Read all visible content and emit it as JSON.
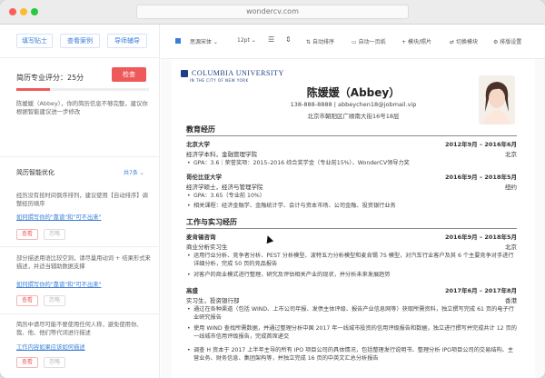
{
  "browser": {
    "url": "wondercv.com"
  },
  "sidebar": {
    "top_buttons": [
      "填写贴士",
      "查看案例",
      "导师辅导"
    ],
    "score_label": "简历专业评分：25分",
    "check_button": "检查",
    "score_percent": 25,
    "intro_text": "陈媛媛（Abbey），你的简历信息不够完整，建议你根据智能建议进一步修改",
    "optimize_title": "简历智能优化",
    "optimize_count": "共7条 ⌄",
    "suggestions": [
      {
        "text": "经历没有按时间倒序排列，建议使用【自动排序】调整经历顺序",
        "link": "如何撰写你的\"靠谱\"和\"可不出来\"",
        "view": "查看",
        "ignore": "忽略"
      },
      {
        "text": "部分描述用语比较空洞，请尽量用动词 + 结果形式来描述，并适当辅助数据支撑",
        "link": "如何撰写你的\"靠谱\"和\"可不出来\"",
        "view": "查看",
        "ignore": "忽略"
      },
      {
        "text": "简历中请尽可能不要使用任何人称，避免使用你、我、他、他们等代词进行描述",
        "link": "工作内容如果应该如何描述",
        "view": "查看",
        "ignore": "忽略"
      }
    ]
  },
  "toolbar": {
    "font": "思源宋体 ⌄",
    "size": "12pt ⌄",
    "items": [
      "自动排序",
      "自动一页纸",
      "模块/照片",
      "切换模块",
      "排版设置"
    ]
  },
  "resume": {
    "logo_main": "COLUMBIA UNIVERSITY",
    "logo_sub": "IN THE CITY OF NEW YORK",
    "name": "陈媛媛（Abbey）",
    "contact": "138-888-8888 | abbeychen18@jobmail.vip",
    "address": "北京市朝阳区广顺南大街16号18层",
    "edu_title": "教育经历",
    "edu": [
      {
        "school": "北京大学",
        "date": "2012年9月 – 2016年6月",
        "degree": "经济学本科，金融管理学院",
        "place": "北京",
        "bullets": [
          "GPA：3.6｜荣誉奖项：2015–2016 综合奖学金（专业前15%）、WonderCV领导力奖"
        ]
      },
      {
        "school": "哥伦比亚大学",
        "date": "2016年9月 – 2018年5月",
        "degree": "经济学硕士，经济与管理学院",
        "place": "纽约",
        "bullets": [
          "GPA：3.65（专业前 10%）",
          "相关课程：经济金融学、金融统计学、会计与资本市场、公司金融、投资银行业务"
        ]
      }
    ],
    "work_title": "工作与实习经历",
    "work": [
      {
        "company": "麦肯锡咨询",
        "date": "2016年9月 – 2018年5月",
        "role": "商业分析实习生",
        "place": "北京",
        "bullets": [
          "运用行业分析、竞争者分析、PEST 分析模型、波特五力分析模型和麦肯锡 7S 模型，对汽车行业客户及其 6 个主要竞争对手进行详细分析，完成 50 页的竞品报告",
          "对客户的商业模式进行整理，研究及评估相关产业的现状，并分析未来发展趋势"
        ]
      },
      {
        "company": "高盛",
        "date": "2017年6月 – 2017年8月",
        "role": "实习生，投资银行部",
        "place": "香港",
        "bullets": [
          "通过在各种渠道（包括 WIND、上市公司年报、发债主体评级、报告产业信息网等）获取所需资料，独立撰写完成 61 页的电子行业研究报告",
          "使用 WIND 查找所需数据，并通过整理分析中国 2017 年一线城市投资的信用评级报告和数据，独立进行撰写并完成共计 12 页的一线城市信用评级报告，完成首席递交"
        ]
      }
    ],
    "extra_bullet": "调查 H 资本于 2017 上半年主导的所有 IPO 项目公司的具体情况，包括整理发行说明书、整理分析 IPO项目公司的交易结构、主营业务、财务信息、集团架构等，并独立完成 16 页的中英文汇总分析报告"
  },
  "colors": {
    "accent_blue": "#3a7ed8",
    "accent_red": "#ee5a5a",
    "logo_navy": "#1c3f86"
  }
}
